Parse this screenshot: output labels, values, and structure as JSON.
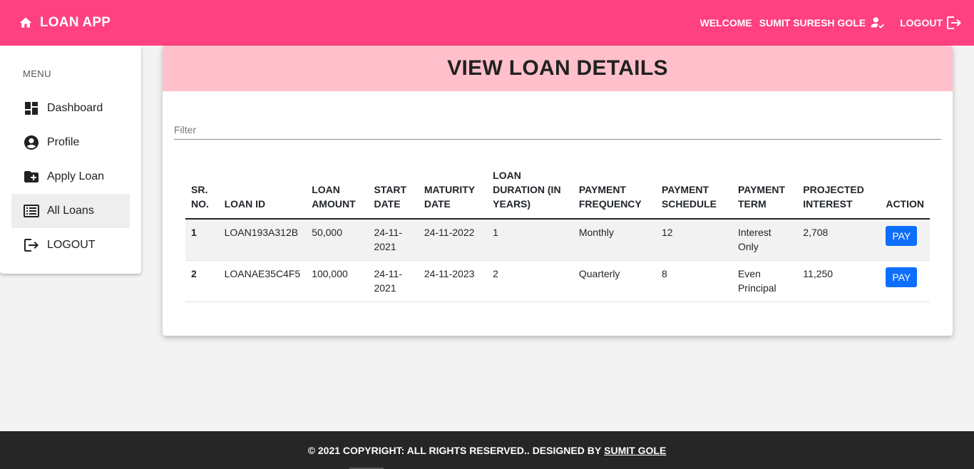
{
  "topbar": {
    "brand": "LOAN APP",
    "welcome": "WELCOME",
    "username": "SUMIT SURESH GOLE",
    "logout": "LOGOUT",
    "color": "#ff4081"
  },
  "sidebar": {
    "menu_title": "MENU",
    "items": [
      {
        "label": "Dashboard",
        "icon": "dashboard-icon"
      },
      {
        "label": "Profile",
        "icon": "account-circle-icon"
      },
      {
        "label": "Apply Loan",
        "icon": "folder-add-icon"
      },
      {
        "label": "All Loans",
        "icon": "list-icon",
        "active": true
      },
      {
        "label": "LOGOUT",
        "icon": "logout-icon"
      }
    ]
  },
  "main": {
    "title": "VIEW LOAN DETAILS",
    "header_color": "#ffc0cb",
    "filter_placeholder": "Filter",
    "table": {
      "headers": [
        "SR. NO.",
        "LOAN ID",
        "LOAN AMOUNT",
        "START DATE",
        "MATURITY DATE",
        "LOAN DURATION (IN YEARS)",
        "PAYMENT FREQUENCY",
        "PAYMENT SCHEDULE",
        "PAYMENT TERM",
        "PROJECTED INTEREST",
        "ACTION"
      ],
      "rows": [
        {
          "sr": "1",
          "loan_id": "LOAN193A312B",
          "amount": "50,000",
          "start": "24-11-2021",
          "maturity": "24-11-2022",
          "duration": "1",
          "frequency": "Monthly",
          "schedule": "12",
          "term": "Interest Only",
          "interest": "2,708",
          "action": "PAY"
        },
        {
          "sr": "2",
          "loan_id": "LOANAE35C4F5",
          "amount": "100,000",
          "start": "24-11-2021",
          "maturity": "24-11-2023",
          "duration": "2",
          "frequency": "Quarterly",
          "schedule": "8",
          "term": "Even Principal",
          "interest": "11,250",
          "action": "PAY"
        }
      ]
    },
    "pay_button_color": "#0d6efd"
  },
  "footer": {
    "text": "© 2021 COPYRIGHT: ALL RIGHTS RESERVED.. DESIGNED BY",
    "link": "SUMIT GOLE"
  }
}
